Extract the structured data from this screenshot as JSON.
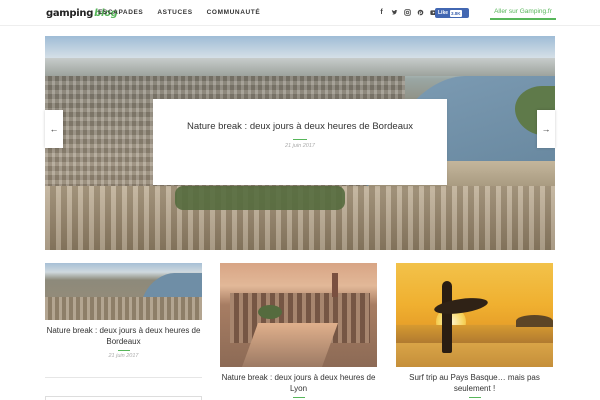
{
  "header": {
    "logo_main": "gamping",
    "logo_accent": "blog",
    "nav": [
      "ESCAPADES",
      "ASTUCES",
      "COMMUNAUTÉ"
    ],
    "social_icons": [
      "facebook-icon",
      "twitter-icon",
      "instagram-icon",
      "pinterest-icon",
      "youtube-icon"
    ],
    "fb_like_label": "Like",
    "fb_like_count": "3.8K",
    "cta_label": "Aller sur Gamping.fr"
  },
  "hero": {
    "title": "Nature break : deux jours à deux heures de Bordeaux",
    "date": "21 juin 2017",
    "prev_arrow": "←",
    "next_arrow": "→"
  },
  "cards": [
    {
      "title": "Nature break : deux jours à deux heures de Bordeaux",
      "date": "21 juin 2017"
    },
    {
      "title": "Nature break : deux jours à deux heures de Lyon",
      "date": ""
    },
    {
      "title": "Surf trip au Pays Basque… mais pas seulement !",
      "date": ""
    }
  ],
  "colors": {
    "accent": "#57b65a",
    "facebook": "#4267b2"
  }
}
